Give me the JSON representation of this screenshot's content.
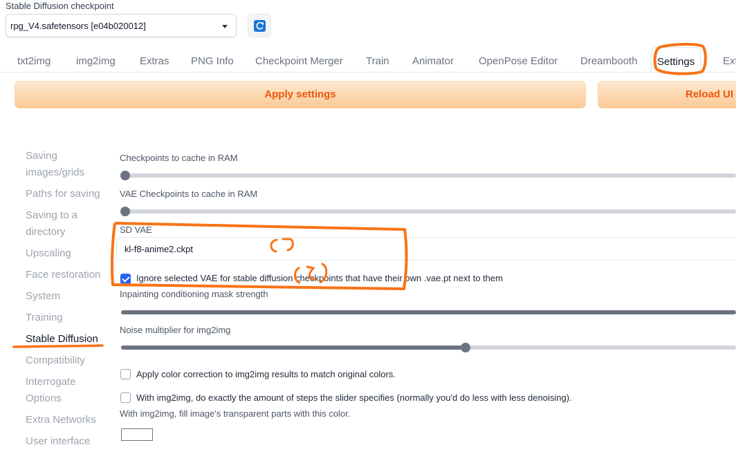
{
  "checkpoint": {
    "label": "Stable Diffusion checkpoint",
    "value": "rpg_V4.safetensors [e04b020012]",
    "refresh_icon": "refresh-icon"
  },
  "tabs": [
    "txt2img",
    "img2img",
    "Extras",
    "PNG Info",
    "Checkpoint Merger",
    "Train",
    "Animator",
    "OpenPose Editor",
    "Dreambooth",
    "Settings",
    "Ext"
  ],
  "active_tab": "Settings",
  "actions": {
    "apply": "Apply settings",
    "reload": "Reload UI"
  },
  "sidebar": [
    "Saving",
    "images/grids",
    "Paths for saving",
    "Saving to a",
    "directory",
    "Upscaling",
    "Face restoration",
    "System",
    "Training",
    "Stable Diffusion",
    "Compatibility",
    "Interrogate",
    "Options",
    "Extra Networks",
    "User interface"
  ],
  "sidebar_active": "Stable Diffusion",
  "settings": {
    "cache_ram": {
      "label": "Checkpoints to cache in RAM",
      "level": 0
    },
    "vae_cache_ram": {
      "label": "VAE Checkpoints to cache in RAM",
      "level": 0
    },
    "sd_vae": {
      "label": "SD VAE",
      "value": "kl-f8-anime2.ckpt"
    },
    "ignore_vae": {
      "label": "Ignore selected VAE for stable diffusion checkpoints that have their own .vae.pt next to them",
      "checked": true
    },
    "inpaint_mask": {
      "label": "Inpainting conditioning mask strength",
      "level": 1.0
    },
    "noise_mult": {
      "label": "Noise multiplier for img2img",
      "level": 0.5
    },
    "color_correction": {
      "label": "Apply color correction to img2img results to match original colors.",
      "checked": false
    },
    "exact_steps": {
      "label": "With img2img, do exactly the amount of steps the slider specifies (normally you'd do less with less denoising).",
      "checked": false
    },
    "fill_color": {
      "label": "With img2img, fill image's transparent parts with this color.",
      "color": "#ffffff"
    }
  },
  "annotations": {
    "mark1": "(1)",
    "mark2": "(2)",
    "color": "#f97316"
  }
}
